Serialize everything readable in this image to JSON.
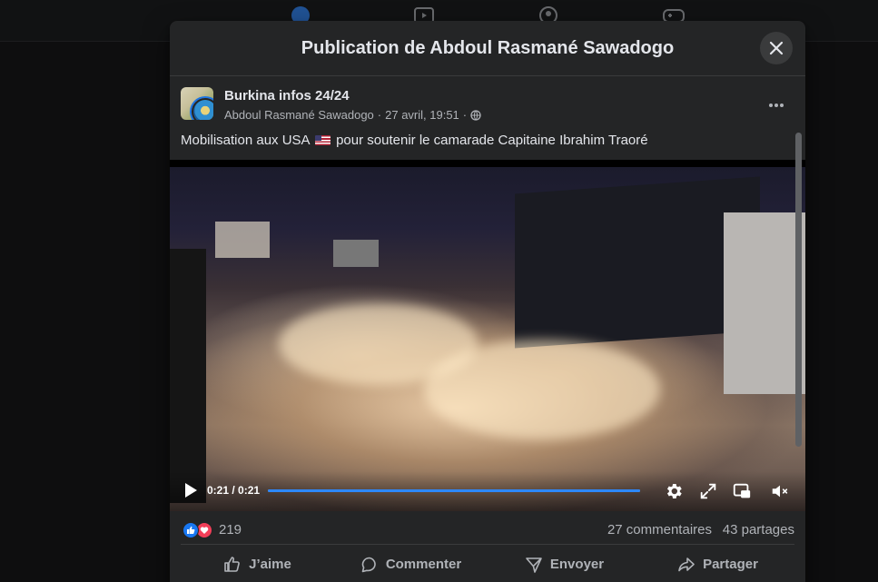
{
  "modal": {
    "title": "Publication de Abdoul Rasmané Sawadogo"
  },
  "post": {
    "page_name": "Burkina infos 24/24",
    "author": "Abdoul Rasmané Sawadogo",
    "separator": "·",
    "date": "27 avril, 19:51",
    "audience_icon": "globe-icon",
    "text_before_flag": "Mobilisation aux USA",
    "flag_icon": "us-flag-icon",
    "text_after_flag": "pour soutenir le camarade Capitaine Ibrahim Traoré"
  },
  "video": {
    "time": "0:21 / 0:21",
    "progress": 1.0,
    "icons": [
      "play-icon",
      "settings-icon",
      "fullscreen-icon",
      "pip-icon",
      "mute-icon"
    ]
  },
  "stats": {
    "reactions": [
      "like-icon",
      "love-icon"
    ],
    "reaction_count": "219",
    "comments": "27 commentaires",
    "shares": "43 partages"
  },
  "actions": {
    "like": "J’aime",
    "comment": "Commenter",
    "send": "Envoyer",
    "share": "Partager"
  },
  "colors": {
    "accent": "#2d88ff",
    "like": "#1877f2",
    "love": "#f33e58",
    "surface": "#242526"
  }
}
